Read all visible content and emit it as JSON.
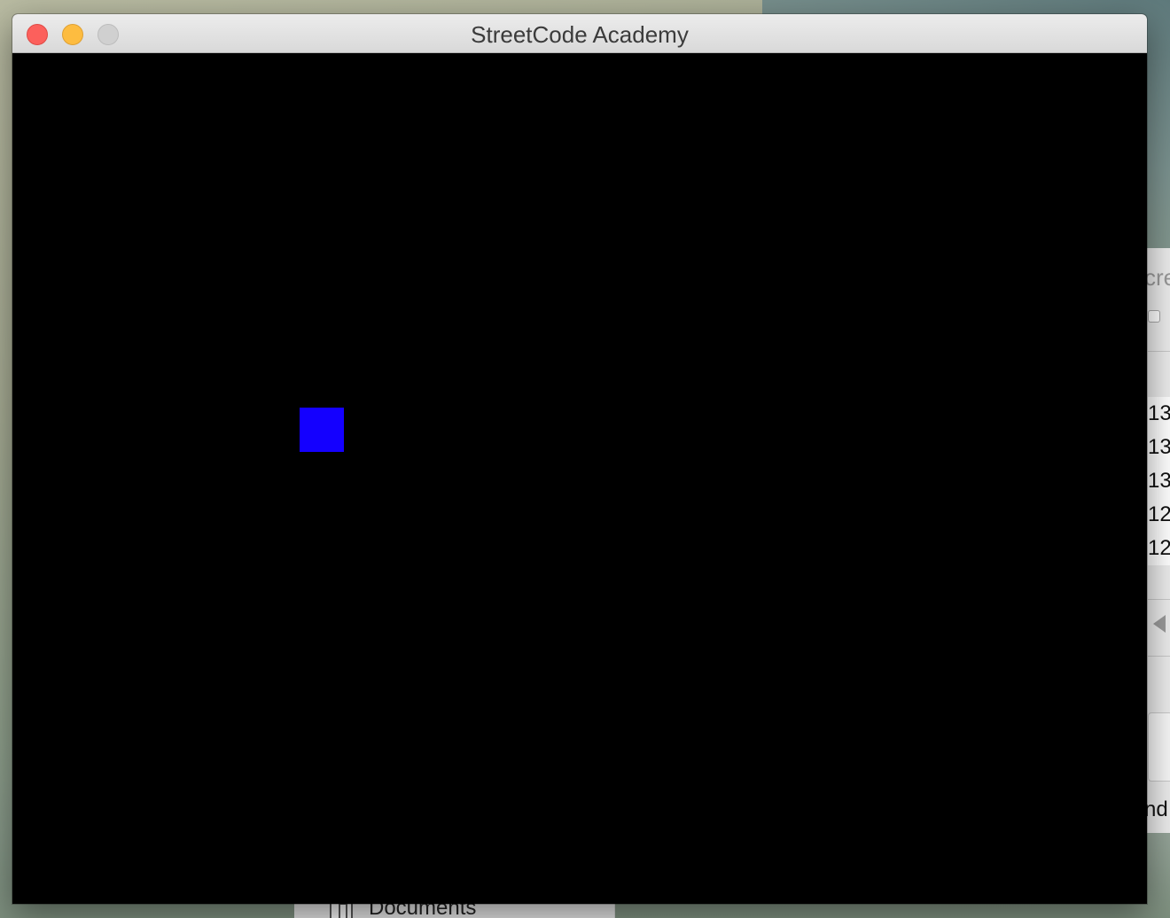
{
  "window": {
    "title": "StreetCode Academy"
  },
  "game": {
    "background_color": "#000000",
    "player_color": "#1400ff"
  },
  "background_window": {
    "title_fragment": "cre",
    "list_rows": [
      "13",
      "13",
      "13",
      "12.",
      "12."
    ],
    "text_fragment": "nd"
  },
  "finder_sidebar": {
    "item_label": "Documents"
  }
}
